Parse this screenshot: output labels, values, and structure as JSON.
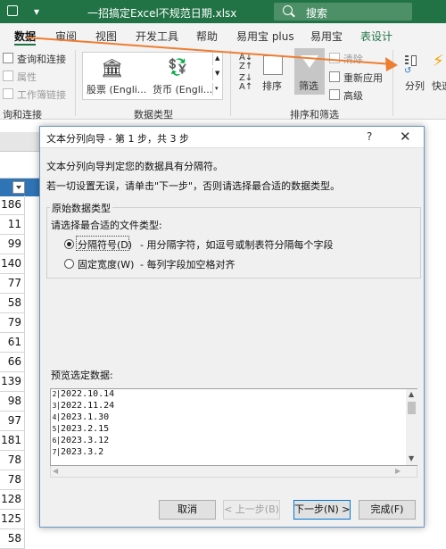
{
  "window": {
    "title": "一招搞定Excel不规范日期.xlsx",
    "search_label": "搜索"
  },
  "ribbon": {
    "tabs": [
      {
        "label": "数据"
      },
      {
        "label": "审阅"
      },
      {
        "label": "视图"
      },
      {
        "label": "开发工具"
      },
      {
        "label": "帮助"
      },
      {
        "label": "易用宝 plus"
      },
      {
        "label": "易用宝"
      },
      {
        "label": "表设计"
      }
    ],
    "query_connect": "查询和连接",
    "properties": "属性",
    "workbook_links": "工作簿链接",
    "group_query": "询和连接",
    "stocks": "股票 (Engli...",
    "currency": "货币 (Engli...",
    "group_datatypes": "数据类型",
    "sort": "排序",
    "filter": "筛选",
    "clear": "清除",
    "reapply": "重新应用",
    "advanced": "高级",
    "group_sortfilter": "排序和筛选",
    "text_to_columns": "分列",
    "quick": "快速",
    "accent_color": "#217346",
    "arrow_color": "#ed7d31"
  },
  "sheet": {
    "rows": [
      "186",
      "11",
      "99",
      "140",
      "77",
      "58",
      "79",
      "61",
      "66",
      "139",
      "98",
      "97",
      "181",
      "78",
      "78",
      "128",
      "125",
      "58"
    ]
  },
  "dialog": {
    "title": "文本分列向导 - 第 1 步，共 3 步",
    "help": "?",
    "close": "✕",
    "intro": "文本分列向导判定您的数据具有分隔符。",
    "instruction": "若一切设置无误，请单击\"下一步\"，否则请选择最合适的数据类型。",
    "group_label": "原始数据类型",
    "choose_label": "请选择最合适的文件类型:",
    "option_delimited": "分隔符号(D)",
    "option_delimited_desc": "- 用分隔字符，如逗号或制表符分隔每个字段",
    "option_fixed": "固定宽度(W)",
    "option_fixed_desc": "- 每列字段加空格对齐",
    "preview_label": "预览选定数据:",
    "preview_lines": [
      {
        "n": "2",
        "text": "2022.10.14"
      },
      {
        "n": "3",
        "text": "2022.11.24"
      },
      {
        "n": "4",
        "text": "2023.1.30"
      },
      {
        "n": "5",
        "text": "2023.2.15"
      },
      {
        "n": "6",
        "text": "2023.3.12"
      },
      {
        "n": "7",
        "text": "2023.3.2"
      }
    ],
    "btn_cancel": "取消",
    "btn_back": "< 上一步(B)",
    "btn_next": "下一步(N) >",
    "btn_finish": "完成(F)"
  }
}
